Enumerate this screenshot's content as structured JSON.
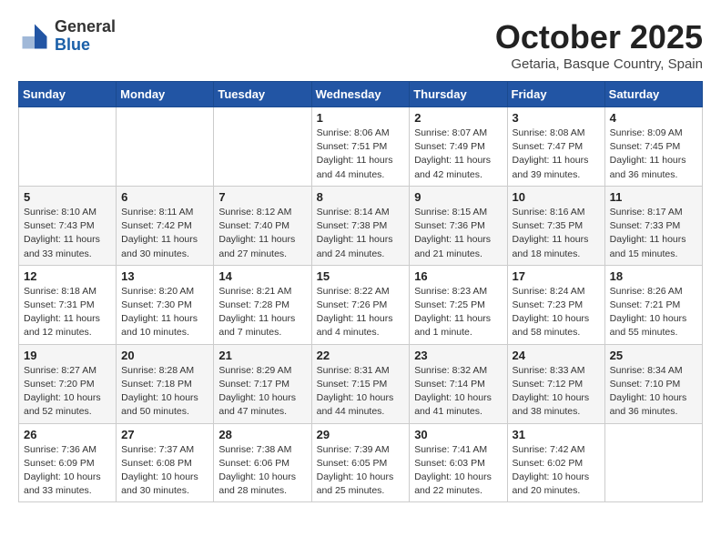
{
  "header": {
    "logo_general": "General",
    "logo_blue": "Blue",
    "month": "October 2025",
    "location": "Getaria, Basque Country, Spain"
  },
  "days_of_week": [
    "Sunday",
    "Monday",
    "Tuesday",
    "Wednesday",
    "Thursday",
    "Friday",
    "Saturday"
  ],
  "weeks": [
    [
      {
        "day": "",
        "info": ""
      },
      {
        "day": "",
        "info": ""
      },
      {
        "day": "",
        "info": ""
      },
      {
        "day": "1",
        "info": "Sunrise: 8:06 AM\nSunset: 7:51 PM\nDaylight: 11 hours\nand 44 minutes."
      },
      {
        "day": "2",
        "info": "Sunrise: 8:07 AM\nSunset: 7:49 PM\nDaylight: 11 hours\nand 42 minutes."
      },
      {
        "day": "3",
        "info": "Sunrise: 8:08 AM\nSunset: 7:47 PM\nDaylight: 11 hours\nand 39 minutes."
      },
      {
        "day": "4",
        "info": "Sunrise: 8:09 AM\nSunset: 7:45 PM\nDaylight: 11 hours\nand 36 minutes."
      }
    ],
    [
      {
        "day": "5",
        "info": "Sunrise: 8:10 AM\nSunset: 7:43 PM\nDaylight: 11 hours\nand 33 minutes."
      },
      {
        "day": "6",
        "info": "Sunrise: 8:11 AM\nSunset: 7:42 PM\nDaylight: 11 hours\nand 30 minutes."
      },
      {
        "day": "7",
        "info": "Sunrise: 8:12 AM\nSunset: 7:40 PM\nDaylight: 11 hours\nand 27 minutes."
      },
      {
        "day": "8",
        "info": "Sunrise: 8:14 AM\nSunset: 7:38 PM\nDaylight: 11 hours\nand 24 minutes."
      },
      {
        "day": "9",
        "info": "Sunrise: 8:15 AM\nSunset: 7:36 PM\nDaylight: 11 hours\nand 21 minutes."
      },
      {
        "day": "10",
        "info": "Sunrise: 8:16 AM\nSunset: 7:35 PM\nDaylight: 11 hours\nand 18 minutes."
      },
      {
        "day": "11",
        "info": "Sunrise: 8:17 AM\nSunset: 7:33 PM\nDaylight: 11 hours\nand 15 minutes."
      }
    ],
    [
      {
        "day": "12",
        "info": "Sunrise: 8:18 AM\nSunset: 7:31 PM\nDaylight: 11 hours\nand 12 minutes."
      },
      {
        "day": "13",
        "info": "Sunrise: 8:20 AM\nSunset: 7:30 PM\nDaylight: 11 hours\nand 10 minutes."
      },
      {
        "day": "14",
        "info": "Sunrise: 8:21 AM\nSunset: 7:28 PM\nDaylight: 11 hours\nand 7 minutes."
      },
      {
        "day": "15",
        "info": "Sunrise: 8:22 AM\nSunset: 7:26 PM\nDaylight: 11 hours\nand 4 minutes."
      },
      {
        "day": "16",
        "info": "Sunrise: 8:23 AM\nSunset: 7:25 PM\nDaylight: 11 hours\nand 1 minute."
      },
      {
        "day": "17",
        "info": "Sunrise: 8:24 AM\nSunset: 7:23 PM\nDaylight: 10 hours\nand 58 minutes."
      },
      {
        "day": "18",
        "info": "Sunrise: 8:26 AM\nSunset: 7:21 PM\nDaylight: 10 hours\nand 55 minutes."
      }
    ],
    [
      {
        "day": "19",
        "info": "Sunrise: 8:27 AM\nSunset: 7:20 PM\nDaylight: 10 hours\nand 52 minutes."
      },
      {
        "day": "20",
        "info": "Sunrise: 8:28 AM\nSunset: 7:18 PM\nDaylight: 10 hours\nand 50 minutes."
      },
      {
        "day": "21",
        "info": "Sunrise: 8:29 AM\nSunset: 7:17 PM\nDaylight: 10 hours\nand 47 minutes."
      },
      {
        "day": "22",
        "info": "Sunrise: 8:31 AM\nSunset: 7:15 PM\nDaylight: 10 hours\nand 44 minutes."
      },
      {
        "day": "23",
        "info": "Sunrise: 8:32 AM\nSunset: 7:14 PM\nDaylight: 10 hours\nand 41 minutes."
      },
      {
        "day": "24",
        "info": "Sunrise: 8:33 AM\nSunset: 7:12 PM\nDaylight: 10 hours\nand 38 minutes."
      },
      {
        "day": "25",
        "info": "Sunrise: 8:34 AM\nSunset: 7:10 PM\nDaylight: 10 hours\nand 36 minutes."
      }
    ],
    [
      {
        "day": "26",
        "info": "Sunrise: 7:36 AM\nSunset: 6:09 PM\nDaylight: 10 hours\nand 33 minutes."
      },
      {
        "day": "27",
        "info": "Sunrise: 7:37 AM\nSunset: 6:08 PM\nDaylight: 10 hours\nand 30 minutes."
      },
      {
        "day": "28",
        "info": "Sunrise: 7:38 AM\nSunset: 6:06 PM\nDaylight: 10 hours\nand 28 minutes."
      },
      {
        "day": "29",
        "info": "Sunrise: 7:39 AM\nSunset: 6:05 PM\nDaylight: 10 hours\nand 25 minutes."
      },
      {
        "day": "30",
        "info": "Sunrise: 7:41 AM\nSunset: 6:03 PM\nDaylight: 10 hours\nand 22 minutes."
      },
      {
        "day": "31",
        "info": "Sunrise: 7:42 AM\nSunset: 6:02 PM\nDaylight: 10 hours\nand 20 minutes."
      },
      {
        "day": "",
        "info": ""
      }
    ]
  ]
}
